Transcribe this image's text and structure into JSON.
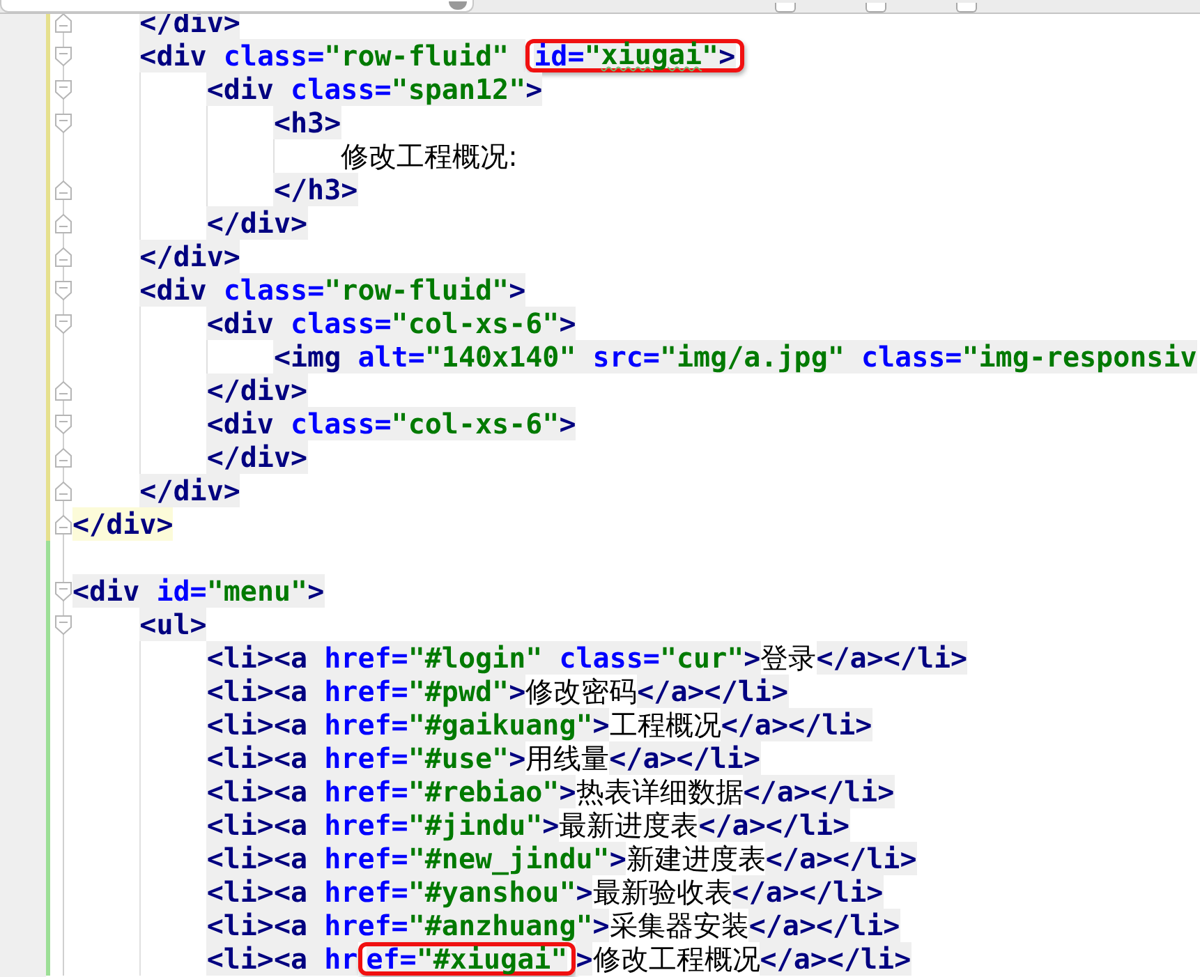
{
  "find_bar": {
    "options": [
      {
        "checked": false
      },
      {
        "checked": false
      },
      {
        "checked": false
      }
    ]
  },
  "lines": [
    {
      "children": [
        {
          "added": false,
          "fold_close": true,
          "segments": [
            {
              "kind": "tag",
              "text": "</div>"
            }
          ]
        },
        {
          "added": false,
          "fold_open": true,
          "segments": [
            {
              "kind": "tag",
              "text": "<div "
            },
            {
              "kind": "attr",
              "text": "class="
            },
            {
              "kind": "value",
              "text": "\"row-fluid\" "
            },
            {
              "kind": "callout",
              "segments": [
                {
                  "kind": "attr",
                  "text": "id="
                },
                {
                  "kind": "value",
                  "text": "\""
                },
                {
                  "kind": "value",
                  "text": "xiugai",
                  "typo": true
                },
                {
                  "kind": "value",
                  "text": "\""
                },
                {
                  "kind": "tag",
                  "text": ">"
                }
              ]
            }
          ],
          "children": [
            {
              "added": false,
              "fold_open": true,
              "segments": [
                {
                  "kind": "tag",
                  "text": "<div "
                },
                {
                  "kind": "attr",
                  "text": "class="
                },
                {
                  "kind": "value",
                  "text": "\"span12\""
                },
                {
                  "kind": "tag",
                  "text": ">"
                }
              ],
              "children": [
                {
                  "added": false,
                  "fold_open": true,
                  "segments": [
                    {
                      "kind": "tag",
                      "text": "<h3>"
                    }
                  ],
                  "children": [
                    {
                      "added": false,
                      "segments": [
                        {
                          "kind": "text",
                          "text": "修改工程概况:"
                        }
                      ]
                    }
                  ]
                },
                {
                  "added": false,
                  "fold_close": true,
                  "segments": [
                    {
                      "kind": "tag",
                      "text": "</h3>"
                    }
                  ]
                }
              ]
            },
            {
              "added": false,
              "fold_close": true,
              "segments": [
                {
                  "kind": "tag",
                  "text": "</div>"
                }
              ]
            }
          ]
        },
        {
          "added": false,
          "fold_close": true,
          "segments": [
            {
              "kind": "tag",
              "text": "</div>"
            }
          ]
        },
        {
          "added": false,
          "fold_open": true,
          "segments": [
            {
              "kind": "tag",
              "text": "<div "
            },
            {
              "kind": "attr",
              "text": "class="
            },
            {
              "kind": "value",
              "text": "\"row-fluid\""
            },
            {
              "kind": "tag",
              "text": ">"
            }
          ],
          "children": [
            {
              "added": false,
              "fold_open": true,
              "segments": [
                {
                  "kind": "tag",
                  "text": "<div "
                },
                {
                  "kind": "attr",
                  "text": "class="
                },
                {
                  "kind": "value",
                  "text": "\"col-xs-6\""
                },
                {
                  "kind": "tag",
                  "text": ">"
                }
              ],
              "children": [
                {
                  "added": false,
                  "segments": [
                    {
                      "kind": "tag",
                      "text": "<img "
                    },
                    {
                      "kind": "attr",
                      "text": "alt="
                    },
                    {
                      "kind": "value",
                      "text": "\"140x140\""
                    },
                    {
                      "kind": "attr",
                      "text": " src="
                    },
                    {
                      "kind": "value",
                      "text": "\"img/a.jpg\""
                    },
                    {
                      "kind": "attr",
                      "text": " class="
                    },
                    {
                      "kind": "value",
                      "text": "\"img-responsiv"
                    }
                  ]
                }
              ]
            },
            {
              "added": false,
              "fold_close": true,
              "segments": [
                {
                  "kind": "tag",
                  "text": "</div>"
                }
              ]
            },
            {
              "added": false,
              "fold_open": true,
              "segments": [
                {
                  "kind": "tag",
                  "text": "<div "
                },
                {
                  "kind": "attr",
                  "text": "class="
                },
                {
                  "kind": "value",
                  "text": "\"col-xs-6\""
                },
                {
                  "kind": "tag",
                  "text": ">"
                }
              ]
            },
            {
              "added": false,
              "fold_close": true,
              "segments": [
                {
                  "kind": "tag",
                  "text": "</div>"
                }
              ]
            }
          ]
        },
        {
          "added": false,
          "fold_close": true,
          "segments": [
            {
              "kind": "tag",
              "text": "</div>"
            }
          ]
        }
      ]
    },
    {
      "added": false,
      "fold_close": true,
      "highlight": true,
      "segments": [
        {
          "kind": "tag",
          "text": "</div>"
        }
      ]
    },
    {
      "added": true
    },
    {
      "added": true,
      "fold_open": true,
      "segments": [
        {
          "kind": "tag",
          "text": "<div "
        },
        {
          "kind": "attr",
          "text": "id="
        },
        {
          "kind": "value",
          "text": "\"menu\""
        },
        {
          "kind": "tag",
          "text": ">"
        }
      ],
      "children": [
        {
          "added": true,
          "fold_open": true,
          "segments": [
            {
              "kind": "tag",
              "text": "<ul>"
            }
          ],
          "children": [
            {
              "added": true,
              "segments": [
                {
                  "kind": "tag",
                  "text": "<li><a "
                },
                {
                  "kind": "attr",
                  "text": "href="
                },
                {
                  "kind": "value",
                  "text": "\"#login\""
                },
                {
                  "kind": "attr",
                  "text": " class="
                },
                {
                  "kind": "value",
                  "text": "\"cur\""
                },
                {
                  "kind": "tag",
                  "text": ">"
                },
                {
                  "kind": "text",
                  "text": "登录"
                },
                {
                  "kind": "tag",
                  "text": "</a></li>"
                }
              ]
            },
            {
              "added": true,
              "segments": [
                {
                  "kind": "tag",
                  "text": "<li><a "
                },
                {
                  "kind": "attr",
                  "text": "href="
                },
                {
                  "kind": "value",
                  "text": "\"#pwd\""
                },
                {
                  "kind": "tag",
                  "text": ">"
                },
                {
                  "kind": "text",
                  "text": "修改密码"
                },
                {
                  "kind": "tag",
                  "text": "</a></li>"
                }
              ]
            },
            {
              "added": true,
              "segments": [
                {
                  "kind": "tag",
                  "text": "<li><a "
                },
                {
                  "kind": "attr",
                  "text": "href="
                },
                {
                  "kind": "value",
                  "text": "\"#gaikuang\""
                },
                {
                  "kind": "tag",
                  "text": ">"
                },
                {
                  "kind": "text",
                  "text": "工程概况"
                },
                {
                  "kind": "tag",
                  "text": "</a></li>"
                }
              ]
            },
            {
              "added": true,
              "segments": [
                {
                  "kind": "tag",
                  "text": "<li><a "
                },
                {
                  "kind": "attr",
                  "text": "href="
                },
                {
                  "kind": "value",
                  "text": "\"#use\""
                },
                {
                  "kind": "tag",
                  "text": ">"
                },
                {
                  "kind": "text",
                  "text": "用线量"
                },
                {
                  "kind": "tag",
                  "text": "</a></li>"
                }
              ]
            },
            {
              "added": true,
              "segments": [
                {
                  "kind": "tag",
                  "text": "<li><a "
                },
                {
                  "kind": "attr",
                  "text": "href="
                },
                {
                  "kind": "value",
                  "text": "\"#rebiao\""
                },
                {
                  "kind": "tag",
                  "text": ">"
                },
                {
                  "kind": "text",
                  "text": "热表详细数据"
                },
                {
                  "kind": "tag",
                  "text": "</a></li>"
                }
              ]
            },
            {
              "added": true,
              "segments": [
                {
                  "kind": "tag",
                  "text": "<li><a "
                },
                {
                  "kind": "attr",
                  "text": "href="
                },
                {
                  "kind": "value",
                  "text": "\"#jindu\""
                },
                {
                  "kind": "tag",
                  "text": ">"
                },
                {
                  "kind": "text",
                  "text": "最新进度表"
                },
                {
                  "kind": "tag",
                  "text": "</a></li>"
                }
              ]
            },
            {
              "added": true,
              "segments": [
                {
                  "kind": "tag",
                  "text": "<li><a "
                },
                {
                  "kind": "attr",
                  "text": "href="
                },
                {
                  "kind": "value",
                  "text": "\"#new_jindu\""
                },
                {
                  "kind": "tag",
                  "text": ">"
                },
                {
                  "kind": "text",
                  "text": "新建进度表"
                },
                {
                  "kind": "tag",
                  "text": "</a></li>"
                }
              ]
            },
            {
              "added": true,
              "segments": [
                {
                  "kind": "tag",
                  "text": "<li><a "
                },
                {
                  "kind": "attr",
                  "text": "href="
                },
                {
                  "kind": "value",
                  "text": "\"#yanshou\""
                },
                {
                  "kind": "tag",
                  "text": ">"
                },
                {
                  "kind": "text",
                  "text": "最新验收表"
                },
                {
                  "kind": "tag",
                  "text": "</a></li>"
                }
              ]
            },
            {
              "added": true,
              "segments": [
                {
                  "kind": "tag",
                  "text": "<li><a "
                },
                {
                  "kind": "attr",
                  "text": "href="
                },
                {
                  "kind": "value",
                  "text": "\"#anzhuang\""
                },
                {
                  "kind": "tag",
                  "text": ">"
                },
                {
                  "kind": "text",
                  "text": "采集器安装"
                },
                {
                  "kind": "tag",
                  "text": "</a></li>"
                }
              ]
            },
            {
              "added": true,
              "segments": [
                {
                  "kind": "tag",
                  "text": "<li><a "
                },
                {
                  "kind": "attr",
                  "text": "hr"
                },
                {
                  "kind": "callout",
                  "segments": [
                    {
                      "kind": "attr",
                      "text": "ef="
                    },
                    {
                      "kind": "value",
                      "text": "\"#xiugai\""
                    }
                  ]
                },
                {
                  "kind": "tag",
                  "text": ">"
                },
                {
                  "kind": "text",
                  "text": "修改工程概况"
                },
                {
                  "kind": "tag",
                  "text": "</a></li>"
                }
              ]
            }
          ]
        }
      ]
    }
  ]
}
